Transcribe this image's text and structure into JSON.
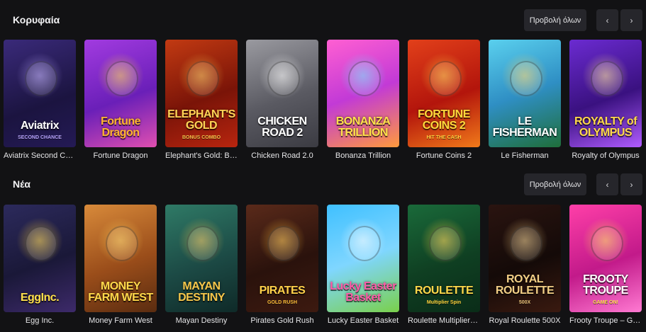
{
  "sections": [
    {
      "title": "Κορυφαία",
      "view_all": "Προβολή όλων",
      "prev": "‹",
      "next": "›",
      "games": [
        {
          "name": "Aviatrix Second Chance",
          "art": "Aviatrix",
          "sub": "SECOND CHANCE",
          "bg": "linear-gradient(160deg,#3a2a7a,#1b1440 60%,#241a55)",
          "accent": "#b9a6ff",
          "text": "#ffffff"
        },
        {
          "name": "Fortune Dragon",
          "art": "Fortune Dragon",
          "sub": "",
          "bg": "linear-gradient(160deg,#a23be0,#6a1fb8 55%,#e04fb0)",
          "accent": "#ffd23c",
          "text": "#ffb52e"
        },
        {
          "name": "Elephant's Gold: Bonus Combo",
          "art": "ELEPHANT'S GOLD",
          "sub": "BONUS COMBO",
          "bg": "linear-gradient(160deg,#c23a12,#7a1408 55%,#b8250f)",
          "accent": "#f6c14a",
          "text": "#ffd456"
        },
        {
          "name": "Chicken Road 2.0",
          "art": "CHICKEN ROAD 2",
          "sub": "",
          "bg": "linear-gradient(160deg,#9a9aa0,#5a5a62 55%,#3b3b42)",
          "accent": "#ffffff",
          "text": "#ffffff"
        },
        {
          "name": "Bonanza Trillion",
          "art": "BONANZA TRILLION",
          "sub": "",
          "bg": "linear-gradient(160deg,#ff5fd2,#c23ad6 50%,#ff9a3c)",
          "accent": "#5fe3ff",
          "text": "#ffe14a"
        },
        {
          "name": "Fortune Coins 2",
          "art": "FORTUNE COINS 2",
          "sub": "HIT THE CASH",
          "bg": "linear-gradient(160deg,#e2401a,#b3150c 55%,#f17a1a)",
          "accent": "#ffcf3f",
          "text": "#ffd93b"
        },
        {
          "name": "Le Fisherman",
          "art": "LE FISHERMAN",
          "sub": "",
          "bg": "linear-gradient(160deg,#5ad0ee,#2f8fc4 50%,#1f6e3a)",
          "accent": "#ffd25a",
          "text": "#ffffff"
        },
        {
          "name": "Royalty of Olympus",
          "art": "ROYALTY of OLYMPUS",
          "sub": "",
          "bg": "linear-gradient(160deg,#6b2bd1,#3a1180 55%,#b05cff)",
          "accent": "#ffe08a",
          "text": "#ffd84a"
        }
      ]
    },
    {
      "title": "Νέα",
      "view_all": "Προβολή όλων",
      "prev": "‹",
      "next": "›",
      "games": [
        {
          "name": "Egg Inc.",
          "art": "EggInc.",
          "sub": "",
          "bg": "linear-gradient(160deg,#2c2a5c,#1a1838 55%,#3d2a6a)",
          "accent": "#ffd23c",
          "text": "#ffe04a"
        },
        {
          "name": "Money Farm West",
          "art": "MONEY FARM WEST",
          "sub": "",
          "bg": "linear-gradient(160deg,#d88a3a,#9a4d1a 55%,#5a2c10)",
          "accent": "#ffd25a",
          "text": "#ffd84a"
        },
        {
          "name": "Mayan Destiny",
          "art": "MAYAN DESTINY",
          "sub": "",
          "bg": "linear-gradient(160deg,#2f7a66,#1c4a45 55%,#0f2a28)",
          "accent": "#f2c14a",
          "text": "#f6c64a"
        },
        {
          "name": "Pirates Gold Rush",
          "art": "PIRATES",
          "sub": "GOLD RUSH",
          "bg": "linear-gradient(160deg,#5a2a1a,#2a120c 55%,#3d1a10)",
          "accent": "#ffbe3a",
          "text": "#ffd14a"
        },
        {
          "name": "Lucky Easter Basket",
          "art": "Lucky Easter Basket",
          "sub": "",
          "bg": "linear-gradient(160deg,#3fc0ff,#7fd6ff 50%,#7ad04a)",
          "accent": "#ffffff",
          "text": "#ff5aa8"
        },
        {
          "name": "Roulette Multiplier Spin",
          "art": "ROULETTE",
          "sub": "Multiplier Spin",
          "bg": "linear-gradient(160deg,#1a6a3a,#0f3f22 55%,#0a2c18)",
          "accent": "#ffd23c",
          "text": "#ffd84a"
        },
        {
          "name": "Royal Roulette 500X",
          "art": "ROYAL ROULETTE",
          "sub": "500X",
          "bg": "linear-gradient(160deg,#2a1410,#140a08 55%,#3a1a10)",
          "accent": "#e9c27a",
          "text": "#f2cf86"
        },
        {
          "name": "Frooty Troupe – Game On",
          "art": "FROOTY TROUPE",
          "sub": "GAME ON!",
          "bg": "linear-gradient(160deg,#ff3fa8,#c21a8a 55%,#ff7ad2)",
          "accent": "#ffe14a",
          "text": "#ffffff"
        }
      ]
    }
  ]
}
